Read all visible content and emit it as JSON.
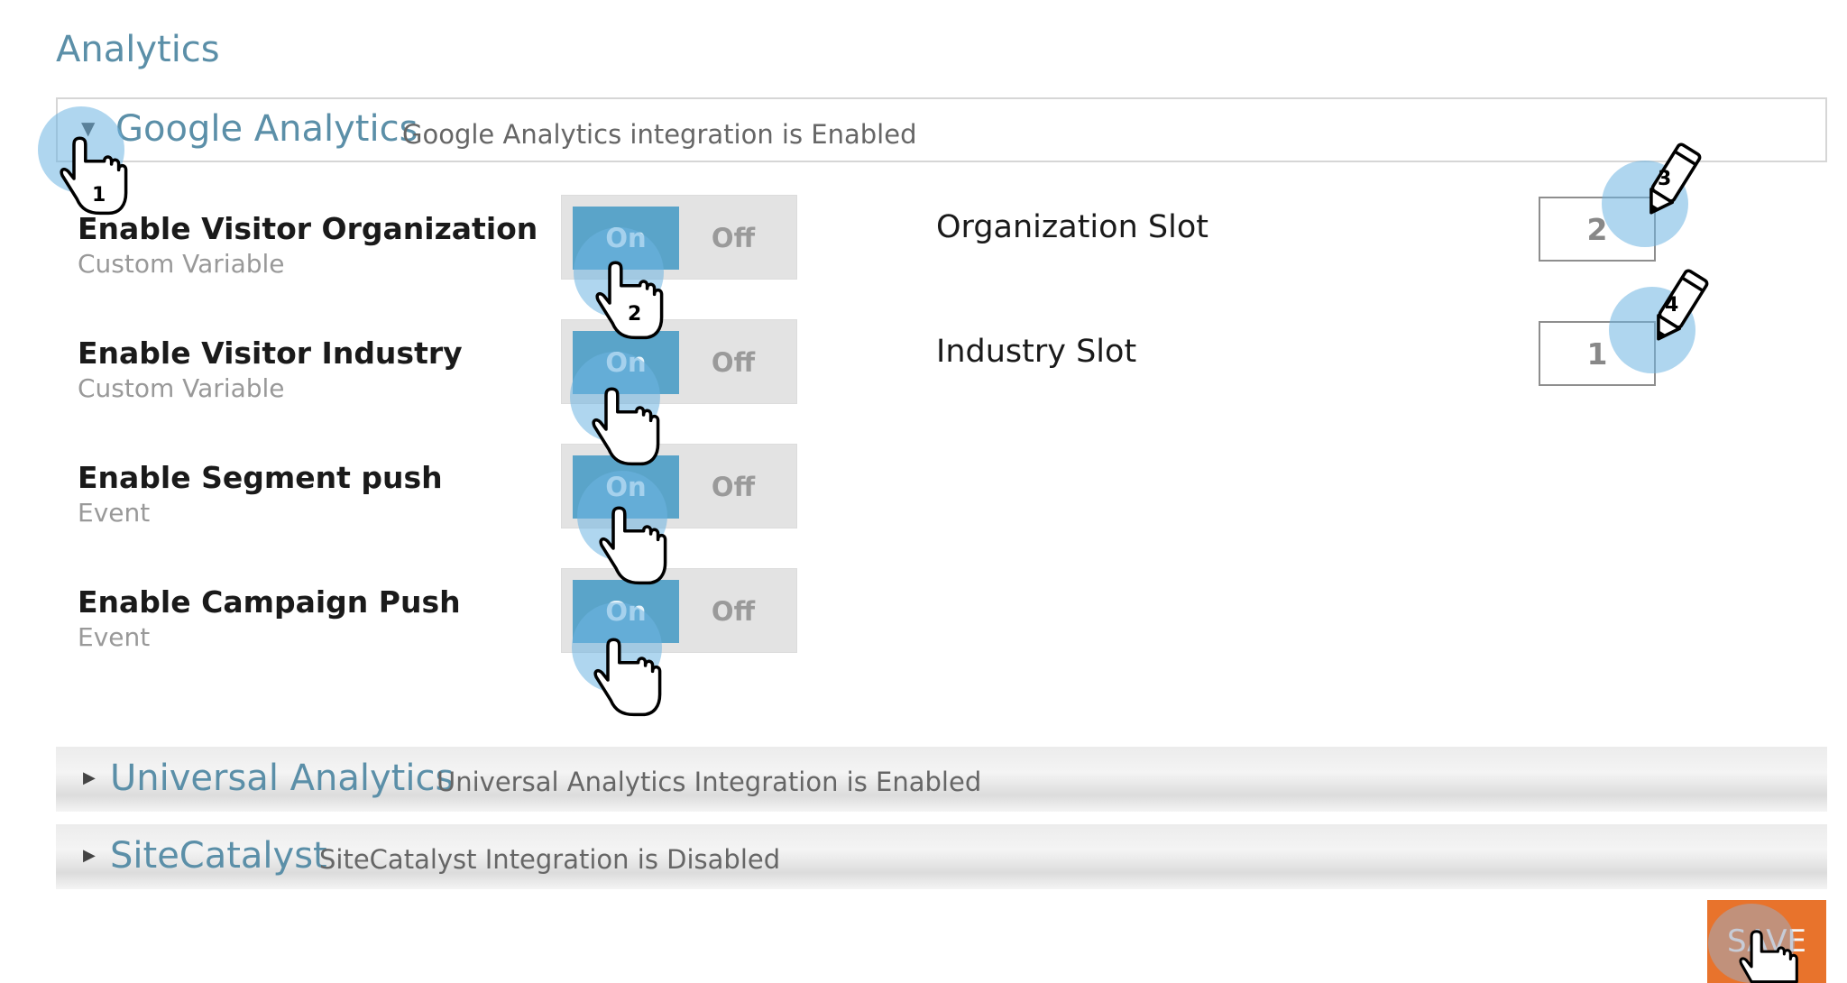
{
  "page": {
    "title": "Analytics"
  },
  "google_analytics": {
    "title": "Google Analytics",
    "status": "Google Analytics integration is Enabled",
    "expanded": true,
    "rows": [
      {
        "title": "Enable Visitor Organization",
        "subtitle": "Custom Variable",
        "on_label": "On",
        "off_label": "Off",
        "value": "On"
      },
      {
        "title": "Enable Visitor Industry",
        "subtitle": "Custom Variable",
        "on_label": "On",
        "off_label": "Off",
        "value": "On"
      },
      {
        "title": "Enable Segment push",
        "subtitle": "Event",
        "on_label": "On",
        "off_label": "Off",
        "value": "On"
      },
      {
        "title": "Enable Campaign Push",
        "subtitle": "Event",
        "on_label": "On",
        "off_label": "Off",
        "value": "On"
      }
    ],
    "slots": [
      {
        "label": "Organization Slot",
        "value": "2"
      },
      {
        "label": "Industry Slot",
        "value": "1"
      }
    ]
  },
  "universal_analytics": {
    "title": "Universal Analytics",
    "status": "Universal Analytics Integration is Enabled",
    "expanded": false
  },
  "sitecatalyst": {
    "title": "SiteCatalyst",
    "status": "SiteCatalyst Integration is Disabled",
    "expanded": false
  },
  "save_label": "SAVE",
  "tutorial_steps": [
    "1",
    "2",
    "3",
    "4"
  ],
  "colors": {
    "accent_title": "#5b8fa8",
    "toggle_on": "#5aa4c9",
    "save_button": "#e8732c",
    "highlight": "#6eb4e1"
  },
  "icons": [
    "caret-down-icon",
    "caret-right-icon",
    "hand-pointer-icon",
    "pencil-icon"
  ]
}
